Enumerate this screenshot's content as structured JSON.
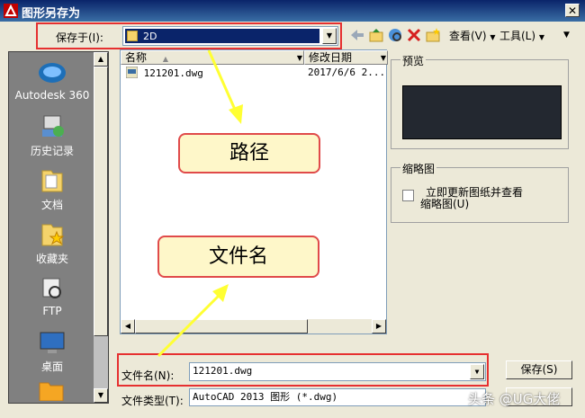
{
  "window": {
    "title": "图形另存为",
    "close_glyph": "✕"
  },
  "toolbar": {
    "save_in_label": "保存于(I):",
    "save_in_value": "2D",
    "views_label": "查看(V)",
    "tools_label": "工具(L)",
    "dropdown_glyph": "▼"
  },
  "places": [
    {
      "label": "Autodesk 360",
      "icon": "cloud-icon"
    },
    {
      "label": "历史记录",
      "icon": "history-icon"
    },
    {
      "label": "文档",
      "icon": "documents-icon"
    },
    {
      "label": "收藏夹",
      "icon": "favorites-icon"
    },
    {
      "label": "FTP",
      "icon": "ftp-icon"
    },
    {
      "label": "桌面",
      "icon": "desktop-icon"
    }
  ],
  "file_list": {
    "columns": [
      "名称",
      "修改日期"
    ],
    "rows": [
      {
        "name": "121201.dwg",
        "modified": "2017/6/6 2..."
      }
    ]
  },
  "preview": {
    "title": "预览"
  },
  "thumbnail": {
    "title": "缩略图",
    "checkbox_label_line1": "立即更新图纸并查看",
    "checkbox_label_line2": "缩略图(U)",
    "checked": false
  },
  "filename": {
    "label": "文件名(N):",
    "value": "121201.dwg"
  },
  "filetype": {
    "label": "文件类型(T):",
    "value": "AutoCAD 2013 图形 (*.dwg)"
  },
  "buttons": {
    "save": "保存(S)"
  },
  "annotations": {
    "path": "路径",
    "filename": "文件名"
  },
  "watermark": "头条 @UG大佬",
  "colors": {
    "highlight": "#e63030",
    "callout_fill": "#fef7c9",
    "arrow": "#ffff33"
  }
}
